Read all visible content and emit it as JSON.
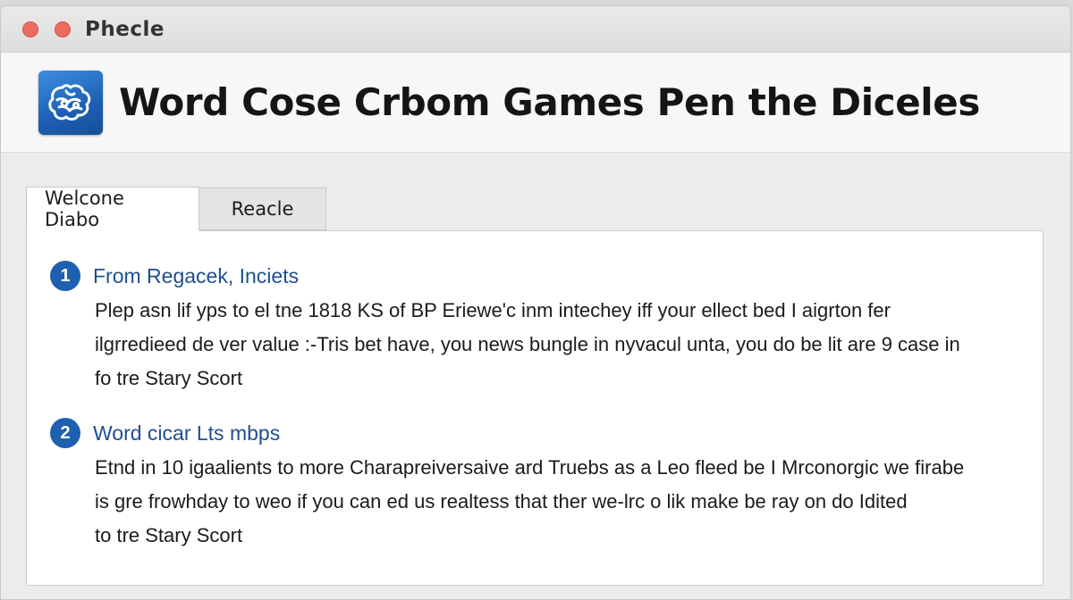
{
  "window": {
    "title": "Phecle"
  },
  "header": {
    "app_icon": "brain-icon",
    "title": "Word Cose Crbom Games Pen the Diceles"
  },
  "tabs": [
    {
      "label": "Welcone Diabo",
      "active": true
    },
    {
      "label": "Reacle",
      "active": false
    }
  ],
  "sections": [
    {
      "number": "1",
      "title": "From Regacek, Inciets",
      "lines": [
        "Plep asn lif yps to el tne 1818 KS of BP Eriewe'c inm intechey iff your ellect bed I aigrton fer",
        "ilgrredieed de ver value :-Tris bet have, you news bungle in nyvacul unta, you do be lit are 9 case in",
        "fo tre Stary Scort"
      ]
    },
    {
      "number": "2",
      "title": "Word cicar Lts mbps",
      "lines": [
        "Etnd in 10 igaalients to more Charapreiversaive ard Truebs as a Leo fleed be I Mrconorgic we firabe",
        "is gre frowhday to weo if you can ed us realtess that ther we-lrc o lik make be ray on do Idited",
        "to tre Stary Scort"
      ]
    }
  ],
  "colors": {
    "accent": "#1f5fb0",
    "section_title": "#1f4f8f",
    "traffic_light": "#ec6a5e"
  }
}
